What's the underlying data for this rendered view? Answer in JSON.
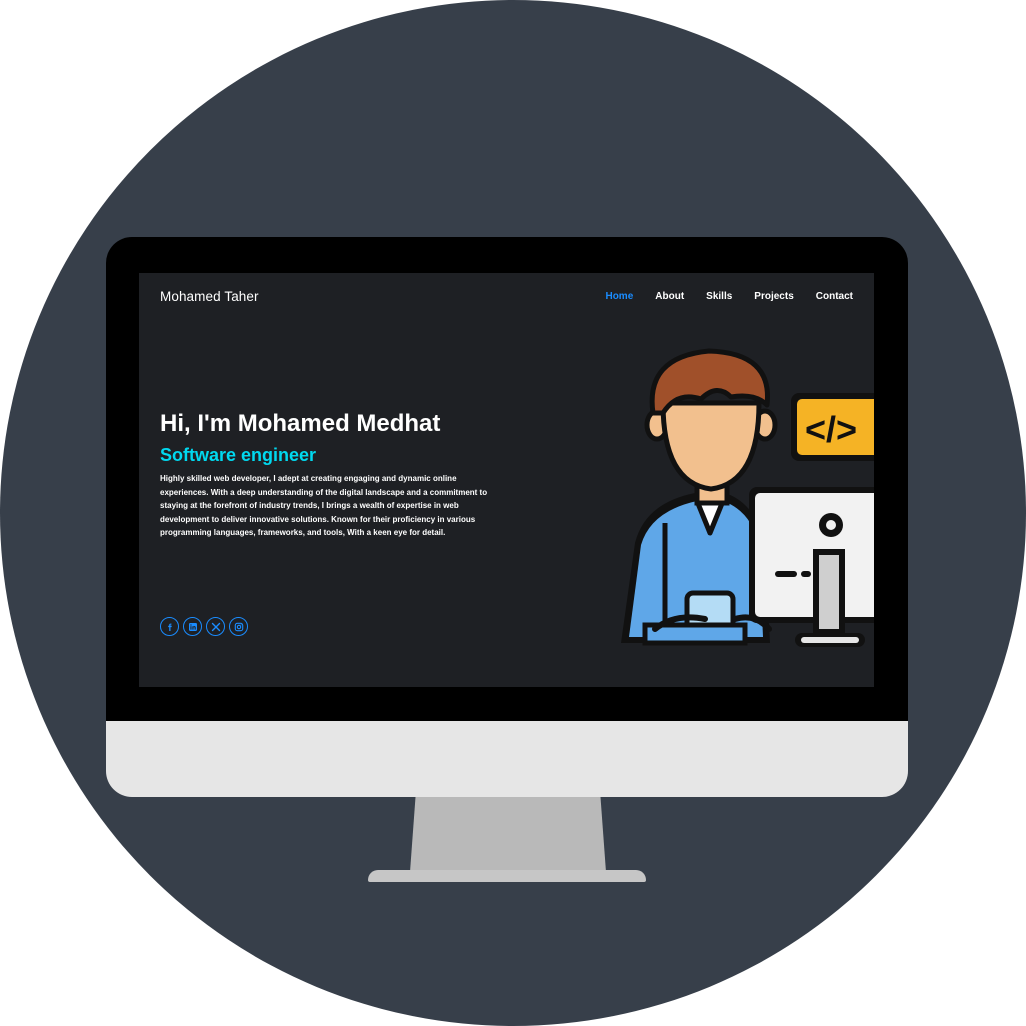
{
  "site": {
    "brand": "Mohamed Taher"
  },
  "nav": {
    "items": [
      {
        "label": "Home",
        "active": true
      },
      {
        "label": "About",
        "active": false
      },
      {
        "label": "Skills",
        "active": false
      },
      {
        "label": "Projects",
        "active": false
      },
      {
        "label": "Contact",
        "active": false
      }
    ]
  },
  "hero": {
    "title": "Hi, I'm Mohamed Medhat",
    "subtitle": "Software engineer",
    "description": "Highly skilled web developer, I adept at creating engaging and dynamic online experiences. With a deep understanding of the digital landscape and a commitment to staying at the forefront of industry trends, I brings a wealth of expertise in web development to deliver innovative solutions. Known for their proficiency in various programming languages, frameworks, and tools, With a keen eye for detail.",
    "code_tag": "</>"
  },
  "socials": [
    {
      "icon": "facebook-icon"
    },
    {
      "icon": "linkedin-icon"
    },
    {
      "icon": "x-twitter-icon"
    },
    {
      "icon": "instagram-icon"
    }
  ],
  "colors": {
    "background": "#373f4a",
    "screen": "#1e2024",
    "accent_blue": "#1a8cff",
    "accent_cyan": "#00d8ef",
    "text": "#ffffff"
  }
}
